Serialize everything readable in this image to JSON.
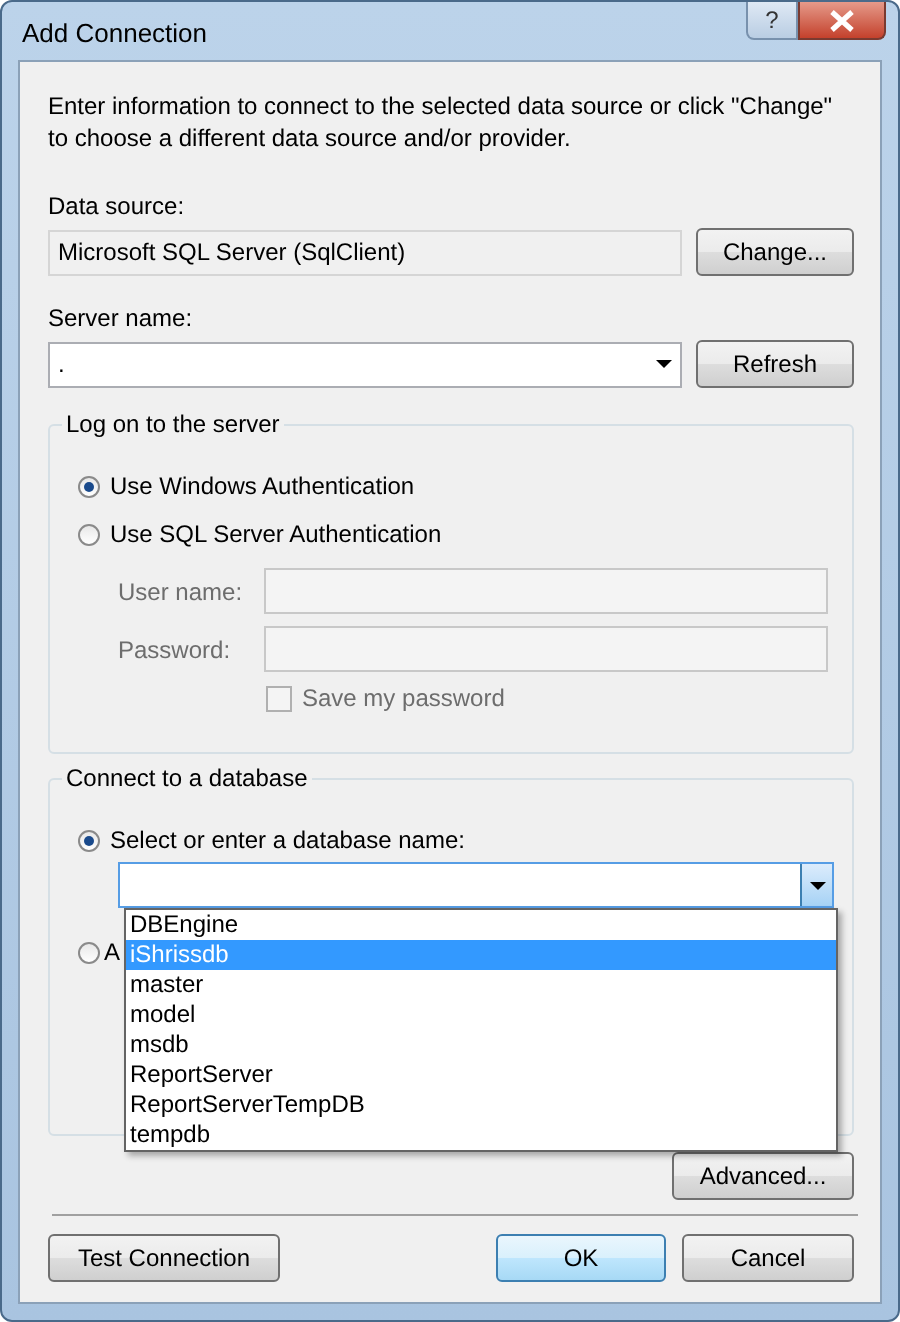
{
  "window": {
    "title": "Add Connection",
    "help": "?"
  },
  "description": "Enter information to connect to the selected data source or click \"Change\" to choose a different data source and/or provider.",
  "data_source": {
    "label": "Data source:",
    "value": "Microsoft SQL Server (SqlClient)",
    "button": "Change..."
  },
  "server_name": {
    "label": "Server name:",
    "value": ".",
    "button": "Refresh"
  },
  "logon": {
    "title": "Log on to the server",
    "options": [
      {
        "label": "Use Windows Authentication",
        "selected": true
      },
      {
        "label": "Use SQL Server Authentication",
        "selected": false
      }
    ],
    "fields": [
      {
        "label": "User name:",
        "disabled": true
      },
      {
        "label": "Password:",
        "disabled": true
      }
    ],
    "save_password": {
      "label": "Save my password",
      "checked": false,
      "disabled": true
    }
  },
  "database": {
    "title": "Connect to a database",
    "options": [
      {
        "label": "Select or enter a database name:",
        "selected": true
      },
      {
        "label": "A",
        "selected": false
      }
    ],
    "dropdown": {
      "expanded": true,
      "items": [
        {
          "label": "DBEngine",
          "selected": false
        },
        {
          "label": "iShrissdb",
          "selected": true
        },
        {
          "label": "master",
          "selected": false
        },
        {
          "label": "model",
          "selected": false
        },
        {
          "label": "msdb",
          "selected": false
        },
        {
          "label": "ReportServer",
          "selected": false
        },
        {
          "label": "ReportServerTempDB",
          "selected": false
        },
        {
          "label": "tempdb",
          "selected": false
        }
      ]
    }
  },
  "advanced_button": "Advanced...",
  "buttons": [
    {
      "label": "Test Connection",
      "kind": "left",
      "default": false
    },
    {
      "label": "OK",
      "kind": "right",
      "default": true
    },
    {
      "label": "Cancel",
      "kind": "right",
      "default": false
    }
  ]
}
